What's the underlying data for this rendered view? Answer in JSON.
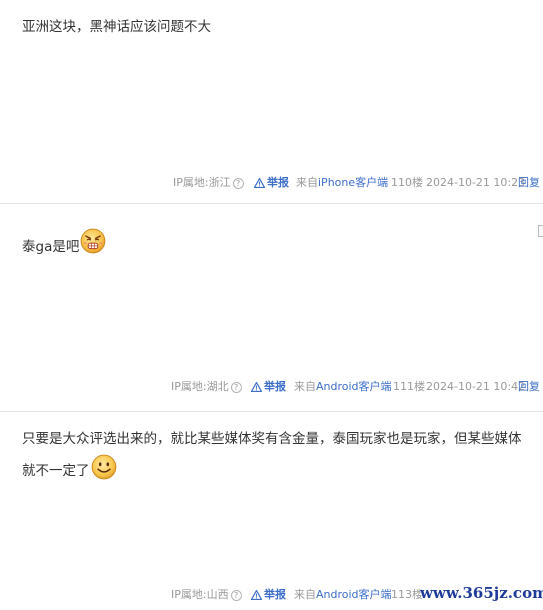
{
  "posts": [
    {
      "content": "亚洲这块，黑神话应该问题不大",
      "emoji": null,
      "ip_label": "IP属地:浙江",
      "report_label": "举报",
      "client_prefix": "来自",
      "client_name": "iPhone客户端",
      "floor": "110楼",
      "time": "2024-10-21 10:23",
      "reply_label": "回复"
    },
    {
      "content": "泰ga是吧",
      "emoji": "angry-face",
      "ip_label": "IP属地:湖北",
      "report_label": "举报",
      "client_prefix": "来自",
      "client_name": "Android客户端",
      "floor": "111楼",
      "time": "2024-10-21 10:42",
      "reply_label": "回复"
    },
    {
      "content": "只要是大众评选出来的，就比某些媒体奖有含金量，泰国玩家也是玩家，但某些媒体就不一定了",
      "emoji": "smile-face",
      "ip_label": "IP属地:山西",
      "report_label": "举报",
      "client_prefix": "来自",
      "client_name": "Android客户端",
      "floor": "113楼",
      "time": "",
      "reply_label": ""
    }
  ],
  "colors": {
    "link": "#3d6ec9",
    "meta": "#999999",
    "text": "#333333",
    "separator": "#e5e5e5"
  },
  "watermark": "www.365jz.com"
}
